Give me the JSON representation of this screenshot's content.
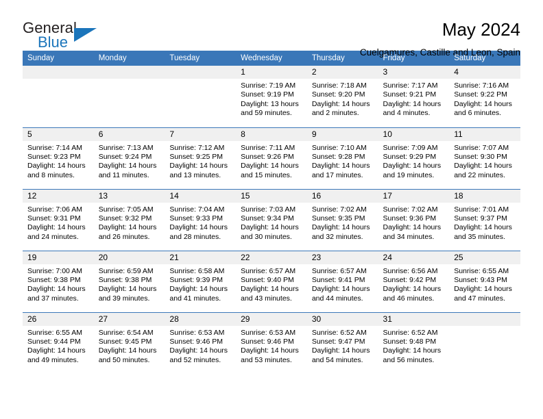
{
  "brand": {
    "name_part1": "General",
    "name_part2": "Blue",
    "accent_color": "#1b75bb"
  },
  "header": {
    "month_title": "May 2024",
    "location": "Cuelgamures, Castille and Leon, Spain"
  },
  "calendar": {
    "header_bg": "#3a77b8",
    "daynum_bg": "#f0f0f0",
    "weekday_headers": [
      "Sunday",
      "Monday",
      "Tuesday",
      "Wednesday",
      "Thursday",
      "Friday",
      "Saturday"
    ],
    "weeks": [
      [
        {
          "day": "",
          "sunrise": "",
          "sunset": "",
          "daylight1": "",
          "daylight2": ""
        },
        {
          "day": "",
          "sunrise": "",
          "sunset": "",
          "daylight1": "",
          "daylight2": ""
        },
        {
          "day": "",
          "sunrise": "",
          "sunset": "",
          "daylight1": "",
          "daylight2": ""
        },
        {
          "day": "1",
          "sunrise": "Sunrise: 7:19 AM",
          "sunset": "Sunset: 9:19 PM",
          "daylight1": "Daylight: 13 hours",
          "daylight2": "and 59 minutes."
        },
        {
          "day": "2",
          "sunrise": "Sunrise: 7:18 AM",
          "sunset": "Sunset: 9:20 PM",
          "daylight1": "Daylight: 14 hours",
          "daylight2": "and 2 minutes."
        },
        {
          "day": "3",
          "sunrise": "Sunrise: 7:17 AM",
          "sunset": "Sunset: 9:21 PM",
          "daylight1": "Daylight: 14 hours",
          "daylight2": "and 4 minutes."
        },
        {
          "day": "4",
          "sunrise": "Sunrise: 7:16 AM",
          "sunset": "Sunset: 9:22 PM",
          "daylight1": "Daylight: 14 hours",
          "daylight2": "and 6 minutes."
        }
      ],
      [
        {
          "day": "5",
          "sunrise": "Sunrise: 7:14 AM",
          "sunset": "Sunset: 9:23 PM",
          "daylight1": "Daylight: 14 hours",
          "daylight2": "and 8 minutes."
        },
        {
          "day": "6",
          "sunrise": "Sunrise: 7:13 AM",
          "sunset": "Sunset: 9:24 PM",
          "daylight1": "Daylight: 14 hours",
          "daylight2": "and 11 minutes."
        },
        {
          "day": "7",
          "sunrise": "Sunrise: 7:12 AM",
          "sunset": "Sunset: 9:25 PM",
          "daylight1": "Daylight: 14 hours",
          "daylight2": "and 13 minutes."
        },
        {
          "day": "8",
          "sunrise": "Sunrise: 7:11 AM",
          "sunset": "Sunset: 9:26 PM",
          "daylight1": "Daylight: 14 hours",
          "daylight2": "and 15 minutes."
        },
        {
          "day": "9",
          "sunrise": "Sunrise: 7:10 AM",
          "sunset": "Sunset: 9:28 PM",
          "daylight1": "Daylight: 14 hours",
          "daylight2": "and 17 minutes."
        },
        {
          "day": "10",
          "sunrise": "Sunrise: 7:09 AM",
          "sunset": "Sunset: 9:29 PM",
          "daylight1": "Daylight: 14 hours",
          "daylight2": "and 19 minutes."
        },
        {
          "day": "11",
          "sunrise": "Sunrise: 7:07 AM",
          "sunset": "Sunset: 9:30 PM",
          "daylight1": "Daylight: 14 hours",
          "daylight2": "and 22 minutes."
        }
      ],
      [
        {
          "day": "12",
          "sunrise": "Sunrise: 7:06 AM",
          "sunset": "Sunset: 9:31 PM",
          "daylight1": "Daylight: 14 hours",
          "daylight2": "and 24 minutes."
        },
        {
          "day": "13",
          "sunrise": "Sunrise: 7:05 AM",
          "sunset": "Sunset: 9:32 PM",
          "daylight1": "Daylight: 14 hours",
          "daylight2": "and 26 minutes."
        },
        {
          "day": "14",
          "sunrise": "Sunrise: 7:04 AM",
          "sunset": "Sunset: 9:33 PM",
          "daylight1": "Daylight: 14 hours",
          "daylight2": "and 28 minutes."
        },
        {
          "day": "15",
          "sunrise": "Sunrise: 7:03 AM",
          "sunset": "Sunset: 9:34 PM",
          "daylight1": "Daylight: 14 hours",
          "daylight2": "and 30 minutes."
        },
        {
          "day": "16",
          "sunrise": "Sunrise: 7:02 AM",
          "sunset": "Sunset: 9:35 PM",
          "daylight1": "Daylight: 14 hours",
          "daylight2": "and 32 minutes."
        },
        {
          "day": "17",
          "sunrise": "Sunrise: 7:02 AM",
          "sunset": "Sunset: 9:36 PM",
          "daylight1": "Daylight: 14 hours",
          "daylight2": "and 34 minutes."
        },
        {
          "day": "18",
          "sunrise": "Sunrise: 7:01 AM",
          "sunset": "Sunset: 9:37 PM",
          "daylight1": "Daylight: 14 hours",
          "daylight2": "and 35 minutes."
        }
      ],
      [
        {
          "day": "19",
          "sunrise": "Sunrise: 7:00 AM",
          "sunset": "Sunset: 9:38 PM",
          "daylight1": "Daylight: 14 hours",
          "daylight2": "and 37 minutes."
        },
        {
          "day": "20",
          "sunrise": "Sunrise: 6:59 AM",
          "sunset": "Sunset: 9:38 PM",
          "daylight1": "Daylight: 14 hours",
          "daylight2": "and 39 minutes."
        },
        {
          "day": "21",
          "sunrise": "Sunrise: 6:58 AM",
          "sunset": "Sunset: 9:39 PM",
          "daylight1": "Daylight: 14 hours",
          "daylight2": "and 41 minutes."
        },
        {
          "day": "22",
          "sunrise": "Sunrise: 6:57 AM",
          "sunset": "Sunset: 9:40 PM",
          "daylight1": "Daylight: 14 hours",
          "daylight2": "and 43 minutes."
        },
        {
          "day": "23",
          "sunrise": "Sunrise: 6:57 AM",
          "sunset": "Sunset: 9:41 PM",
          "daylight1": "Daylight: 14 hours",
          "daylight2": "and 44 minutes."
        },
        {
          "day": "24",
          "sunrise": "Sunrise: 6:56 AM",
          "sunset": "Sunset: 9:42 PM",
          "daylight1": "Daylight: 14 hours",
          "daylight2": "and 46 minutes."
        },
        {
          "day": "25",
          "sunrise": "Sunrise: 6:55 AM",
          "sunset": "Sunset: 9:43 PM",
          "daylight1": "Daylight: 14 hours",
          "daylight2": "and 47 minutes."
        }
      ],
      [
        {
          "day": "26",
          "sunrise": "Sunrise: 6:55 AM",
          "sunset": "Sunset: 9:44 PM",
          "daylight1": "Daylight: 14 hours",
          "daylight2": "and 49 minutes."
        },
        {
          "day": "27",
          "sunrise": "Sunrise: 6:54 AM",
          "sunset": "Sunset: 9:45 PM",
          "daylight1": "Daylight: 14 hours",
          "daylight2": "and 50 minutes."
        },
        {
          "day": "28",
          "sunrise": "Sunrise: 6:53 AM",
          "sunset": "Sunset: 9:46 PM",
          "daylight1": "Daylight: 14 hours",
          "daylight2": "and 52 minutes."
        },
        {
          "day": "29",
          "sunrise": "Sunrise: 6:53 AM",
          "sunset": "Sunset: 9:46 PM",
          "daylight1": "Daylight: 14 hours",
          "daylight2": "and 53 minutes."
        },
        {
          "day": "30",
          "sunrise": "Sunrise: 6:52 AM",
          "sunset": "Sunset: 9:47 PM",
          "daylight1": "Daylight: 14 hours",
          "daylight2": "and 54 minutes."
        },
        {
          "day": "31",
          "sunrise": "Sunrise: 6:52 AM",
          "sunset": "Sunset: 9:48 PM",
          "daylight1": "Daylight: 14 hours",
          "daylight2": "and 56 minutes."
        },
        {
          "day": "",
          "sunrise": "",
          "sunset": "",
          "daylight1": "",
          "daylight2": ""
        }
      ]
    ]
  }
}
